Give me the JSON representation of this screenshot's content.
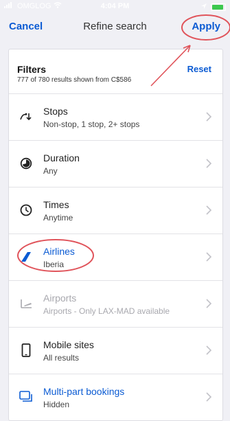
{
  "status": {
    "carrier": "OMGLOG",
    "time": "4:04 PM"
  },
  "nav": {
    "cancel": "Cancel",
    "title": "Refine search",
    "apply": "Apply"
  },
  "filters": {
    "title": "Filters",
    "subtitle": "777 of 780 results shown from C$586",
    "reset": "Reset"
  },
  "rows": [
    {
      "title": "Stops",
      "subtitle": "Non-stop, 1 stop, 2+ stops",
      "icon": "stops-icon"
    },
    {
      "title": "Duration",
      "subtitle": "Any",
      "icon": "duration-icon"
    },
    {
      "title": "Times",
      "subtitle": "Anytime",
      "icon": "clock-icon"
    },
    {
      "title": "Airlines",
      "subtitle": "Iberia",
      "icon": "airline-tail-icon"
    },
    {
      "title": "Airports",
      "subtitle": "Airports - Only LAX-MAD available",
      "icon": "airport-icon"
    },
    {
      "title": "Mobile sites",
      "subtitle": "All results",
      "icon": "mobile-icon"
    },
    {
      "title": "Multi-part bookings",
      "subtitle": "Hidden",
      "icon": "multi-part-icon"
    }
  ],
  "colors": {
    "accent": "#0b5bd3",
    "annotation": "#e0535a",
    "background": "#f0f0f5"
  }
}
